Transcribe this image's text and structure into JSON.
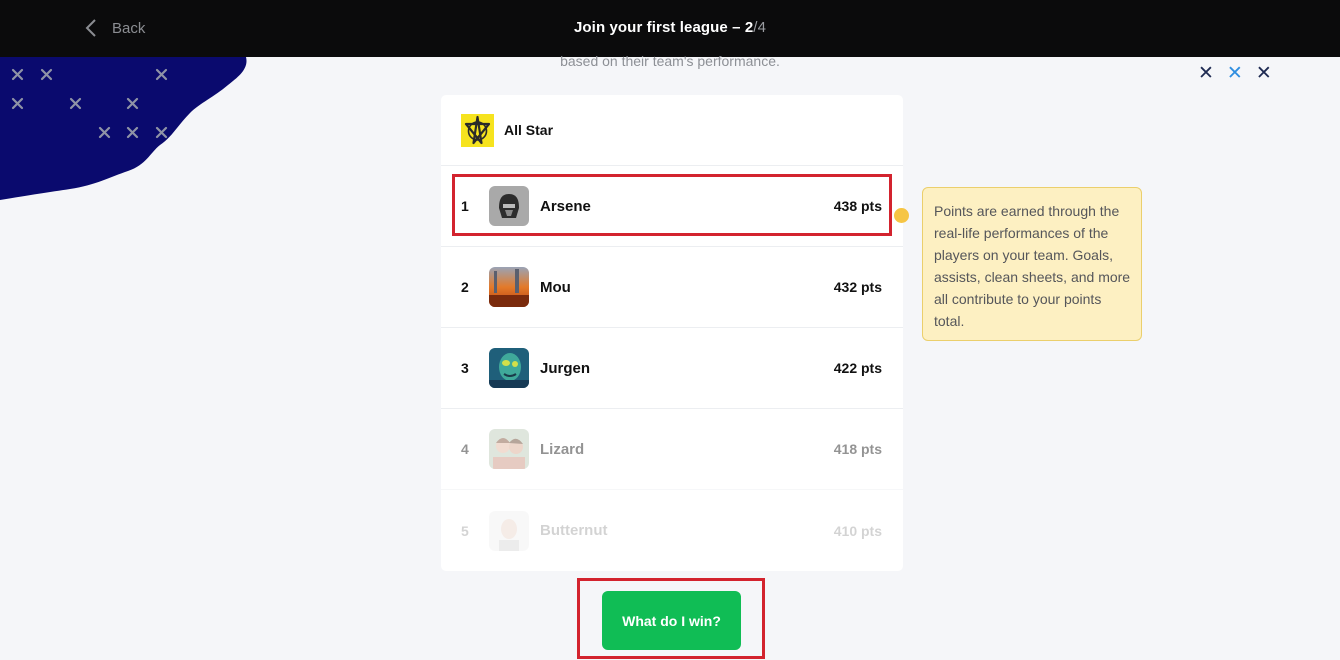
{
  "header": {
    "back_label": "Back",
    "title_main": "Join your first league – 2",
    "title_total": "/4"
  },
  "subtitle": "based on their team's performance.",
  "league": {
    "name": "All Star",
    "rows": [
      {
        "rank": "1",
        "name": "Arsene",
        "points": "438 pts"
      },
      {
        "rank": "2",
        "name": "Mou",
        "points": "432 pts"
      },
      {
        "rank": "3",
        "name": "Jurgen",
        "points": "422 pts"
      },
      {
        "rank": "4",
        "name": "Lizard",
        "points": "418 pts"
      },
      {
        "rank": "5",
        "name": "Butternut",
        "points": "410 pts"
      }
    ]
  },
  "tooltip": "Points are earned through the real-life performances of the players on your team. Goals, assists, clean sheets, and more all contribute to your points total.",
  "cta_label": "What do I win?",
  "decor": {
    "x_mark": "✕",
    "x_colors": [
      "#1e2a52",
      "#2f8ee0",
      "#1e2a52"
    ]
  },
  "colors": {
    "accent_green": "#10bd55",
    "highlight_red": "#d3232e",
    "tooltip_bg": "#fdf0c2",
    "blob_navy": "#0a0a6e"
  }
}
